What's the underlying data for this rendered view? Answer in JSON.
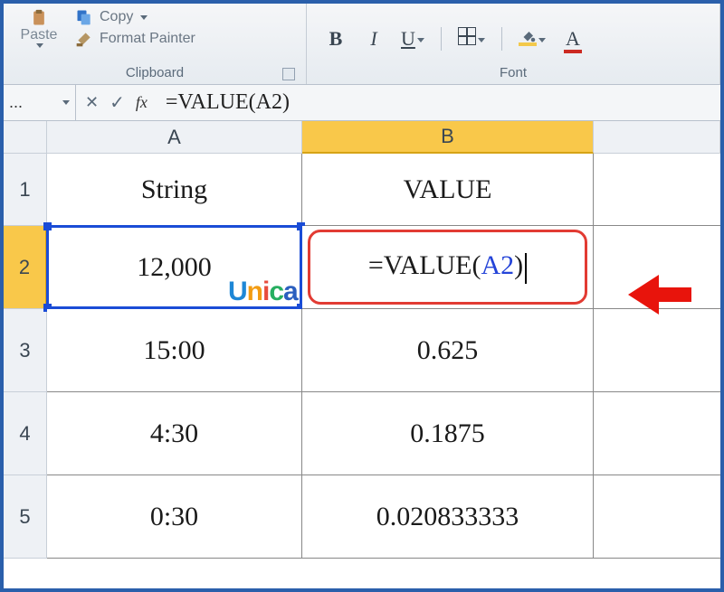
{
  "ribbon": {
    "clipboard": {
      "group_label": "Clipboard",
      "paste_label": "Paste",
      "copy_label": "Copy",
      "format_painter_label": "Format Painter"
    },
    "font": {
      "group_label": "Font",
      "bold_label": "B",
      "italic_label": "I",
      "underline_label": "U",
      "font_color_label": "A"
    }
  },
  "formula_bar": {
    "name_hint": "...",
    "cancel_icon": "✕",
    "enter_icon": "✓",
    "fx_label": "fx",
    "formula": "=VALUE(A2)"
  },
  "columns": {
    "a": "A",
    "b": "B"
  },
  "rows": [
    "1",
    "2",
    "3",
    "4",
    "5"
  ],
  "cells": {
    "a1": "String",
    "b1": "VALUE",
    "a2": "12,000",
    "b2_prefix": "=VALUE(",
    "b2_ref": "A2",
    "b2_suffix": ")",
    "a3": "15:00",
    "b3": "0.625",
    "a4": "4:30",
    "b4": "0.1875",
    "a5": "0:30",
    "b5": "0.020833333"
  },
  "watermark": {
    "u": "U",
    "n": "n",
    "i": "i",
    "c": "c",
    "a": "a"
  },
  "chart_data": {
    "type": "table",
    "title": "VALUE function example",
    "columns": [
      "String",
      "VALUE"
    ],
    "rows": [
      [
        "12,000",
        "=VALUE(A2)"
      ],
      [
        "15:00",
        0.625
      ],
      [
        "4:30",
        0.1875
      ],
      [
        "0:30",
        0.020833333
      ]
    ]
  }
}
